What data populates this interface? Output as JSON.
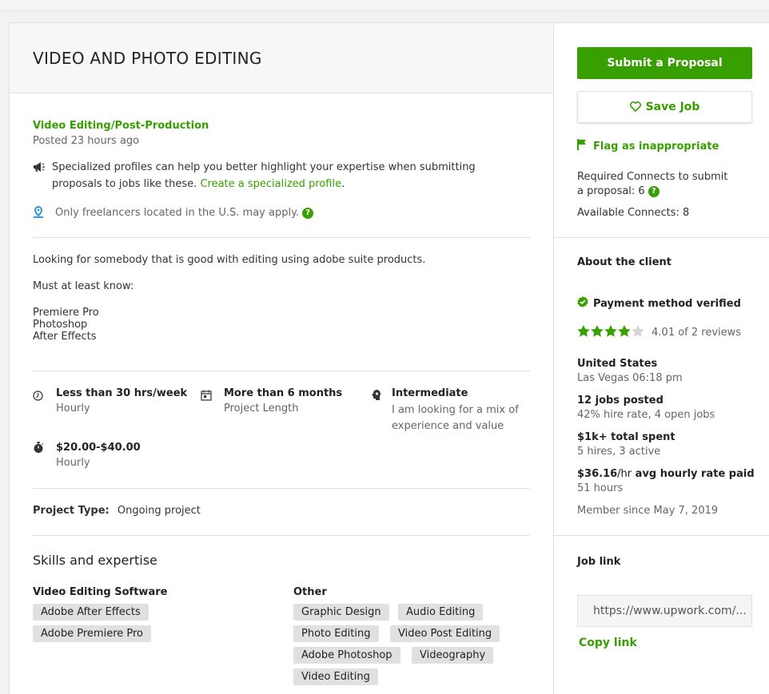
{
  "job": {
    "title": "VIDEO AND PHOTO EDITING",
    "category": "Video Editing/Post-Production",
    "posted": "Posted 23 hours ago",
    "specialized_text": "Specialized profiles can help you better highlight your expertise when submitting",
    "specialized_text2": "proposals to jobs like these.",
    "specialized_link": "Create a specialized profile",
    "specialized_period": ".",
    "location_note": "Only freelancers located in the U.S. may apply.",
    "description": [
      "Looking for somebody that is good with editing using adobe suite products.",
      "Must at least know:",
      "Premiere Pro",
      "Photoshop",
      "After Effects"
    ],
    "features": [
      {
        "icon": "clock-icon",
        "title": "Less than 30 hrs/week",
        "sub": "Hourly"
      },
      {
        "icon": "calendar-icon",
        "title": "More than 6 months",
        "sub": "Project Length"
      },
      {
        "icon": "brain-icon",
        "title": "Intermediate",
        "sub": "I am looking for a mix of",
        "sub2": "experience and value"
      },
      {
        "icon": "stopwatch-icon",
        "title": "$20.00-$40.00",
        "sub": "Hourly"
      }
    ],
    "project_type_label": "Project Type:",
    "project_type_value": "Ongoing project",
    "skills_heading": "Skills and expertise",
    "skill_groups": [
      {
        "name": "Video Editing Software",
        "tags": [
          "Adobe After Effects",
          "Adobe Premiere Pro"
        ]
      },
      {
        "name": "Other",
        "tags": [
          "Graphic Design",
          "Audio Editing",
          "Photo Editing",
          "Video Post Editing",
          "Adobe Photoshop",
          "Videography",
          "Video Editing"
        ]
      }
    ]
  },
  "sidebar": {
    "submit_label": "Submit a Proposal",
    "save_label": "Save Job",
    "flag_label": "Flag as inappropriate",
    "connects_required_1": "Required Connects to submit",
    "connects_required_2": "a proposal: 6",
    "connects_available": "Available Connects: 8",
    "about_heading": "About the client",
    "payment_verified": "Payment method verified",
    "rating": 4.01,
    "rating_text": "4.01 of 2 reviews",
    "country": "United States",
    "city_time": "Las Vegas 06:18 pm",
    "jobs_posted": "12 jobs posted",
    "hire_rate": "42% hire rate, 4 open jobs",
    "total_spent": "$1k+ total spent",
    "hires": "5 hires, 3 active",
    "avg_rate": "$36.16",
    "avg_rate_unit": "/hr",
    "avg_rate_suffix": "avg hourly rate paid",
    "hours": "51 hours",
    "member_since": "Member since May 7, 2019",
    "job_link_heading": "Job link",
    "job_link_value": "https://www.upwork.com/...",
    "copy_link": "Copy link"
  },
  "colors": {
    "brand_green": "#37a000",
    "star_gray": "#d5d5d5",
    "location_blue": "#1e88e5"
  }
}
